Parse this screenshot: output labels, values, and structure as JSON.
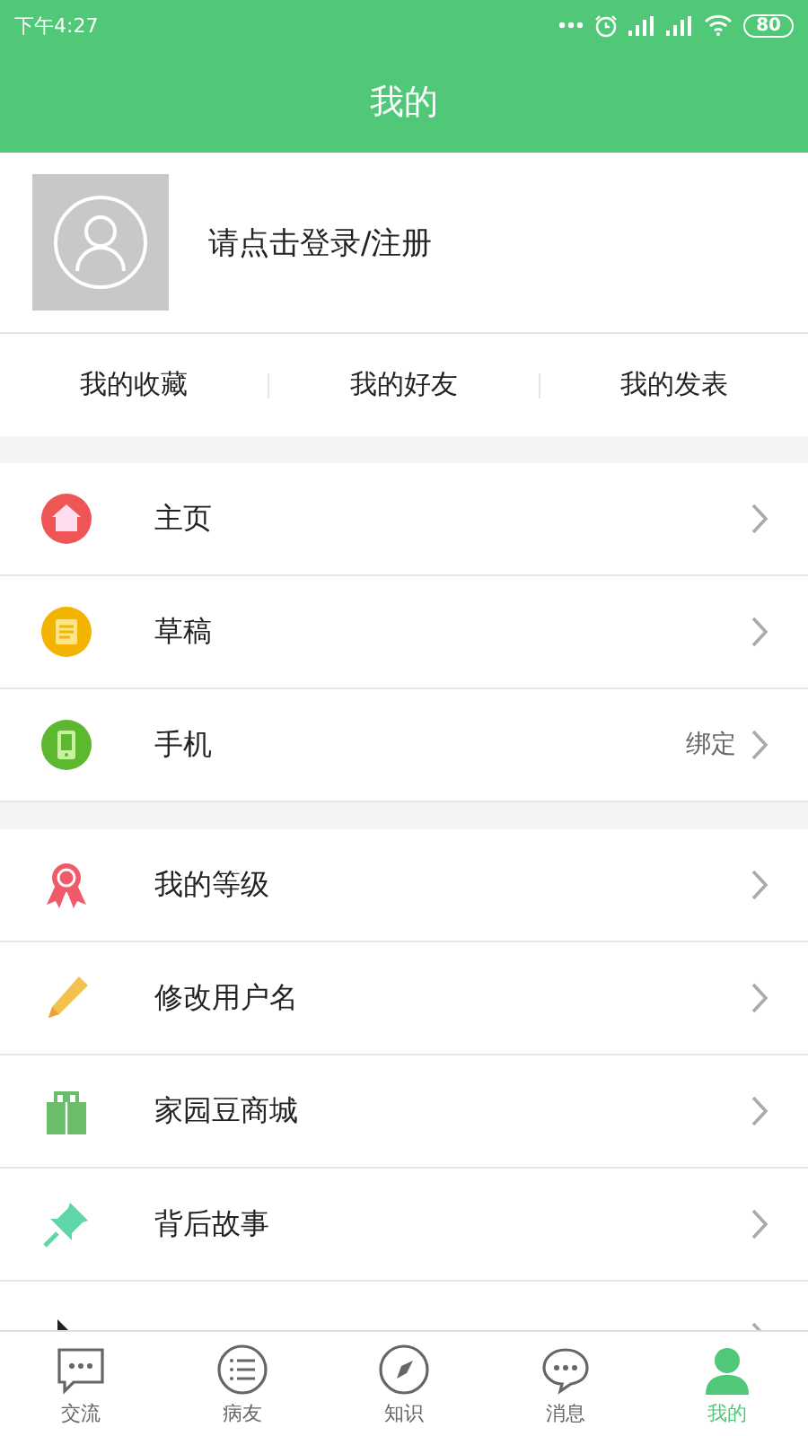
{
  "status_bar": {
    "time": "下午4:27",
    "battery": "80"
  },
  "header": {
    "title": "我的"
  },
  "profile": {
    "prompt": "请点击登录/注册"
  },
  "quick_links": [
    "我的收藏",
    "我的好友",
    "我的发表"
  ],
  "menu_groups": [
    {
      "items": [
        {
          "kind": "home",
          "label": "主页"
        },
        {
          "kind": "draft",
          "label": "草稿"
        },
        {
          "kind": "phone",
          "label": "手机",
          "value": "绑定"
        }
      ]
    },
    {
      "items": [
        {
          "kind": "medal",
          "label": "我的等级"
        },
        {
          "kind": "pencil",
          "label": "修改用户名"
        },
        {
          "kind": "gift",
          "label": "家园豆商城"
        },
        {
          "kind": "pin",
          "label": "背后故事"
        },
        {
          "kind": "partial"
        }
      ]
    }
  ],
  "tab_bar": [
    {
      "kind": "chat",
      "label": "交流",
      "selected": false
    },
    {
      "kind": "list",
      "label": "病友",
      "selected": false
    },
    {
      "kind": "compass",
      "label": "知识",
      "selected": false
    },
    {
      "kind": "message",
      "label": "消息",
      "selected": false
    },
    {
      "kind": "person",
      "label": "我的",
      "selected": true
    }
  ]
}
